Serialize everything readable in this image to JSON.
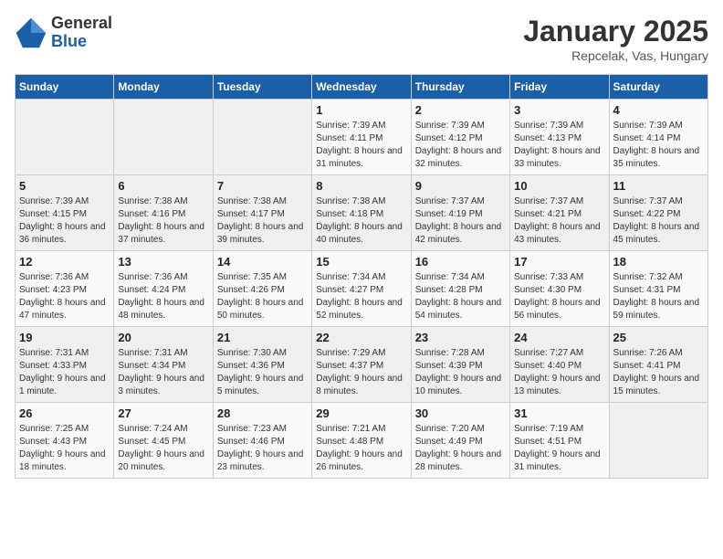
{
  "header": {
    "logo_general": "General",
    "logo_blue": "Blue",
    "month_year": "January 2025",
    "location": "Repcelak, Vas, Hungary"
  },
  "weekdays": [
    "Sunday",
    "Monday",
    "Tuesday",
    "Wednesday",
    "Thursday",
    "Friday",
    "Saturday"
  ],
  "weeks": [
    [
      {
        "day": "",
        "info": ""
      },
      {
        "day": "",
        "info": ""
      },
      {
        "day": "",
        "info": ""
      },
      {
        "day": "1",
        "info": "Sunrise: 7:39 AM\nSunset: 4:11 PM\nDaylight: 8 hours and 31 minutes."
      },
      {
        "day": "2",
        "info": "Sunrise: 7:39 AM\nSunset: 4:12 PM\nDaylight: 8 hours and 32 minutes."
      },
      {
        "day": "3",
        "info": "Sunrise: 7:39 AM\nSunset: 4:13 PM\nDaylight: 8 hours and 33 minutes."
      },
      {
        "day": "4",
        "info": "Sunrise: 7:39 AM\nSunset: 4:14 PM\nDaylight: 8 hours and 35 minutes."
      }
    ],
    [
      {
        "day": "5",
        "info": "Sunrise: 7:39 AM\nSunset: 4:15 PM\nDaylight: 8 hours and 36 minutes."
      },
      {
        "day": "6",
        "info": "Sunrise: 7:38 AM\nSunset: 4:16 PM\nDaylight: 8 hours and 37 minutes."
      },
      {
        "day": "7",
        "info": "Sunrise: 7:38 AM\nSunset: 4:17 PM\nDaylight: 8 hours and 39 minutes."
      },
      {
        "day": "8",
        "info": "Sunrise: 7:38 AM\nSunset: 4:18 PM\nDaylight: 8 hours and 40 minutes."
      },
      {
        "day": "9",
        "info": "Sunrise: 7:37 AM\nSunset: 4:19 PM\nDaylight: 8 hours and 42 minutes."
      },
      {
        "day": "10",
        "info": "Sunrise: 7:37 AM\nSunset: 4:21 PM\nDaylight: 8 hours and 43 minutes."
      },
      {
        "day": "11",
        "info": "Sunrise: 7:37 AM\nSunset: 4:22 PM\nDaylight: 8 hours and 45 minutes."
      }
    ],
    [
      {
        "day": "12",
        "info": "Sunrise: 7:36 AM\nSunset: 4:23 PM\nDaylight: 8 hours and 47 minutes."
      },
      {
        "day": "13",
        "info": "Sunrise: 7:36 AM\nSunset: 4:24 PM\nDaylight: 8 hours and 48 minutes."
      },
      {
        "day": "14",
        "info": "Sunrise: 7:35 AM\nSunset: 4:26 PM\nDaylight: 8 hours and 50 minutes."
      },
      {
        "day": "15",
        "info": "Sunrise: 7:34 AM\nSunset: 4:27 PM\nDaylight: 8 hours and 52 minutes."
      },
      {
        "day": "16",
        "info": "Sunrise: 7:34 AM\nSunset: 4:28 PM\nDaylight: 8 hours and 54 minutes."
      },
      {
        "day": "17",
        "info": "Sunrise: 7:33 AM\nSunset: 4:30 PM\nDaylight: 8 hours and 56 minutes."
      },
      {
        "day": "18",
        "info": "Sunrise: 7:32 AM\nSunset: 4:31 PM\nDaylight: 8 hours and 59 minutes."
      }
    ],
    [
      {
        "day": "19",
        "info": "Sunrise: 7:31 AM\nSunset: 4:33 PM\nDaylight: 9 hours and 1 minute."
      },
      {
        "day": "20",
        "info": "Sunrise: 7:31 AM\nSunset: 4:34 PM\nDaylight: 9 hours and 3 minutes."
      },
      {
        "day": "21",
        "info": "Sunrise: 7:30 AM\nSunset: 4:36 PM\nDaylight: 9 hours and 5 minutes."
      },
      {
        "day": "22",
        "info": "Sunrise: 7:29 AM\nSunset: 4:37 PM\nDaylight: 9 hours and 8 minutes."
      },
      {
        "day": "23",
        "info": "Sunrise: 7:28 AM\nSunset: 4:39 PM\nDaylight: 9 hours and 10 minutes."
      },
      {
        "day": "24",
        "info": "Sunrise: 7:27 AM\nSunset: 4:40 PM\nDaylight: 9 hours and 13 minutes."
      },
      {
        "day": "25",
        "info": "Sunrise: 7:26 AM\nSunset: 4:41 PM\nDaylight: 9 hours and 15 minutes."
      }
    ],
    [
      {
        "day": "26",
        "info": "Sunrise: 7:25 AM\nSunset: 4:43 PM\nDaylight: 9 hours and 18 minutes."
      },
      {
        "day": "27",
        "info": "Sunrise: 7:24 AM\nSunset: 4:45 PM\nDaylight: 9 hours and 20 minutes."
      },
      {
        "day": "28",
        "info": "Sunrise: 7:23 AM\nSunset: 4:46 PM\nDaylight: 9 hours and 23 minutes."
      },
      {
        "day": "29",
        "info": "Sunrise: 7:21 AM\nSunset: 4:48 PM\nDaylight: 9 hours and 26 minutes."
      },
      {
        "day": "30",
        "info": "Sunrise: 7:20 AM\nSunset: 4:49 PM\nDaylight: 9 hours and 28 minutes."
      },
      {
        "day": "31",
        "info": "Sunrise: 7:19 AM\nSunset: 4:51 PM\nDaylight: 9 hours and 31 minutes."
      },
      {
        "day": "",
        "info": ""
      }
    ]
  ]
}
